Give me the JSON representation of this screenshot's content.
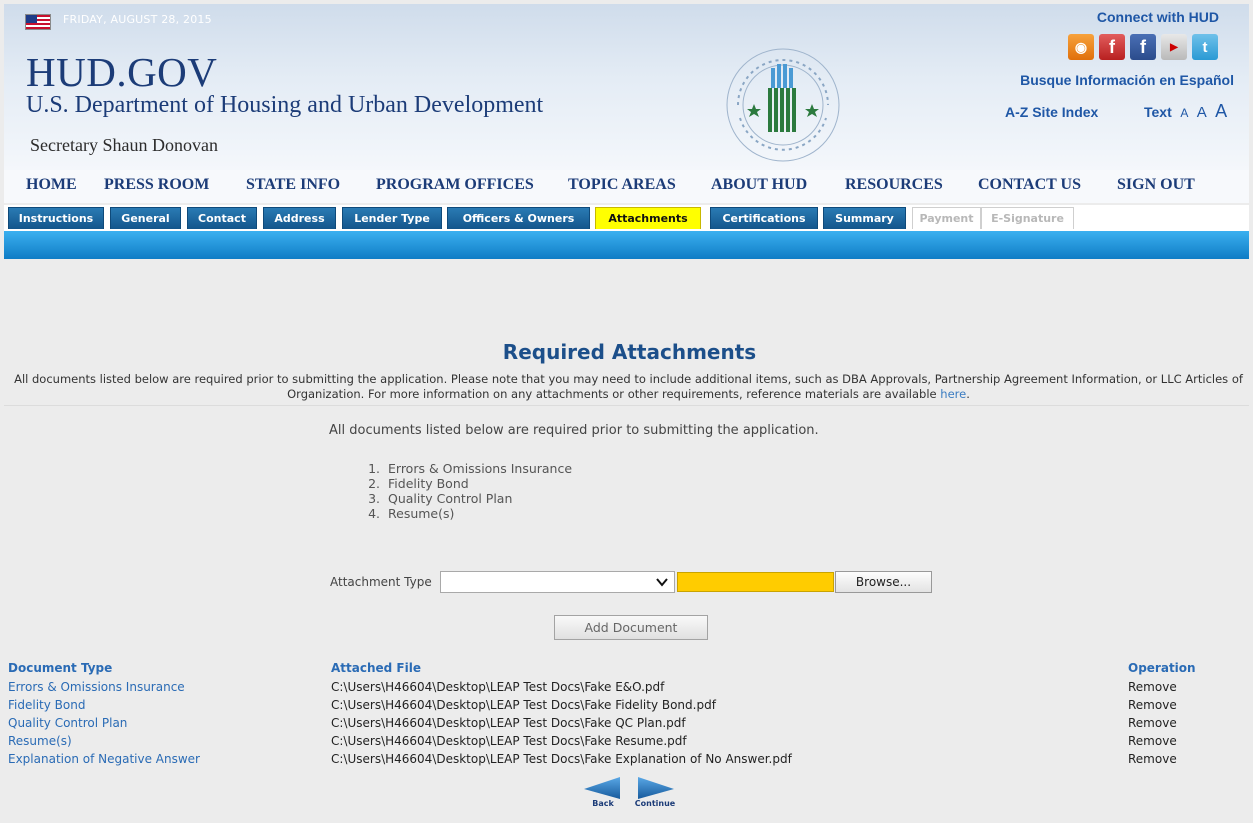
{
  "header": {
    "date": "FRIDAY, AUGUST 28, 2015",
    "site_title": "HUD.GOV",
    "department": "U.S. Department of Housing and Urban Development",
    "secretary": "Secretary Shaun Donovan",
    "connect_label": "Connect with HUD",
    "espanol_link": "Busque Información en Español",
    "az_index": "A-Z Site Index",
    "text_size_label": "Text",
    "text_size_small": "A",
    "text_size_medium": "A",
    "text_size_large": "A",
    "social_icons": [
      "rss-icon",
      "facebook-icon",
      "facebook-icon",
      "youtube-icon",
      "twitter-icon"
    ]
  },
  "main_nav": [
    "HOME",
    "PRESS ROOM",
    "STATE INFO",
    "PROGRAM OFFICES",
    "TOPIC AREAS",
    "ABOUT HUD",
    "RESOURCES",
    "CONTACT US",
    "SIGN OUT"
  ],
  "tabs": [
    {
      "label": "Instructions",
      "state": "normal"
    },
    {
      "label": "General",
      "state": "normal"
    },
    {
      "label": "Contact",
      "state": "normal"
    },
    {
      "label": "Address",
      "state": "normal"
    },
    {
      "label": "Lender Type",
      "state": "normal"
    },
    {
      "label": "Officers & Owners",
      "state": "normal"
    },
    {
      "label": "Attachments",
      "state": "active"
    },
    {
      "label": "Certifications",
      "state": "normal"
    },
    {
      "label": "Summary",
      "state": "normal"
    },
    {
      "label": "Payment",
      "state": "disabled"
    },
    {
      "label": "E-Signature",
      "state": "disabled"
    }
  ],
  "page": {
    "heading": "Required Attachments",
    "intro_text": "All documents listed below are required prior to submitting the application. Please note that you may need to include additional items, such as DBA Approvals, Partnership Agreement Information, or LLC Articles of Organization. For more information on any attachments or other requirements, reference materials are available",
    "intro_link": "here",
    "required_text": "All documents listed below are required prior to submitting the application.",
    "required_items": [
      {
        "num": "1.",
        "label": "Errors & Omissions Insurance"
      },
      {
        "num": "2.",
        "label": "Fidelity Bond"
      },
      {
        "num": "3.",
        "label": "Quality Control Plan"
      },
      {
        "num": "4.",
        "label": "Resume(s)"
      }
    ]
  },
  "form": {
    "attachment_type_label": "Attachment Type",
    "attachment_type_value": "",
    "browse_label": "Browse...",
    "add_document_label": "Add Document"
  },
  "documents": {
    "headers": {
      "type": "Document Type",
      "file": "Attached File",
      "operation": "Operation"
    },
    "rows": [
      {
        "type": "Errors & Omissions Insurance",
        "file": "C:\\Users\\H46604\\Desktop\\LEAP Test Docs\\Fake E&O.pdf",
        "operation": "Remove"
      },
      {
        "type": "Fidelity Bond",
        "file": "C:\\Users\\H46604\\Desktop\\LEAP Test Docs\\Fake Fidelity Bond.pdf",
        "operation": "Remove"
      },
      {
        "type": "Quality Control Plan",
        "file": "C:\\Users\\H46604\\Desktop\\LEAP Test Docs\\Fake QC Plan.pdf",
        "operation": "Remove"
      },
      {
        "type": "Resume(s)",
        "file": "C:\\Users\\H46604\\Desktop\\LEAP Test Docs\\Fake Resume.pdf",
        "operation": "Remove"
      },
      {
        "type": "Explanation of Negative Answer",
        "file": "C:\\Users\\H46604\\Desktop\\LEAP Test Docs\\Fake Explanation of No Answer.pdf",
        "operation": "Remove"
      }
    ]
  },
  "footer_nav": {
    "back": "Back",
    "continue": "Continue"
  },
  "colors": {
    "link_blue": "#2a6bb5",
    "tab_blue": "#13558b",
    "active_tab": "#ffff00",
    "band_blue": "#0f7cc5",
    "file_field": "#ffcc00"
  }
}
